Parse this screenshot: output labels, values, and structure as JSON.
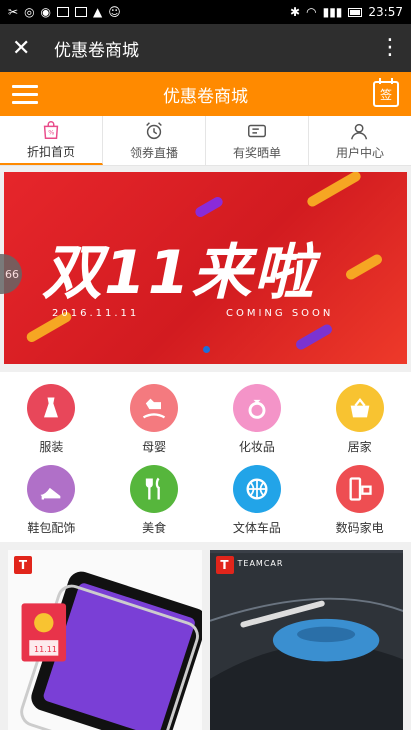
{
  "status": {
    "time": "23:57"
  },
  "wx": {
    "title": "优惠卷商城"
  },
  "app": {
    "title": "优惠卷商城",
    "calendar_label": "签"
  },
  "tabs": [
    {
      "label": "折扣首页",
      "icon": "shopping-bag-icon"
    },
    {
      "label": "领券直播",
      "icon": "alarm-clock-icon"
    },
    {
      "label": "有奖晒单",
      "icon": "ticket-icon"
    },
    {
      "label": "用户中心",
      "icon": "user-icon"
    }
  ],
  "banner": {
    "headline": "双11来啦",
    "date": "2016.11.11",
    "tagline": "COMING SOON"
  },
  "side_badge": "66",
  "categories": [
    {
      "label": "服装",
      "icon": "dress-icon",
      "color": "#e8475a"
    },
    {
      "label": "母婴",
      "icon": "rocking-horse-icon",
      "color": "#f47a7f"
    },
    {
      "label": "化妆品",
      "icon": "ring-icon",
      "color": "#f494c8"
    },
    {
      "label": "居家",
      "icon": "basket-icon",
      "color": "#f8c331"
    },
    {
      "label": "鞋包配饰",
      "icon": "high-heel-icon",
      "color": "#b070c8"
    },
    {
      "label": "美食",
      "icon": "fork-knife-icon",
      "color": "#56b63c"
    },
    {
      "label": "文体车品",
      "icon": "ball-icon",
      "color": "#22a4e8"
    },
    {
      "label": "数码家电",
      "icon": "appliance-icon",
      "color": "#ee4e52"
    }
  ],
  "products": [
    {
      "badge": "T",
      "brand": "",
      "image": "screen-protector-image",
      "coupon": "11.11"
    },
    {
      "badge": "T",
      "brand": "TEAMCAR",
      "image": "car-duster-image"
    }
  ],
  "colors": {
    "accent": "#ff8a00",
    "banner_red": "#e6262b"
  }
}
